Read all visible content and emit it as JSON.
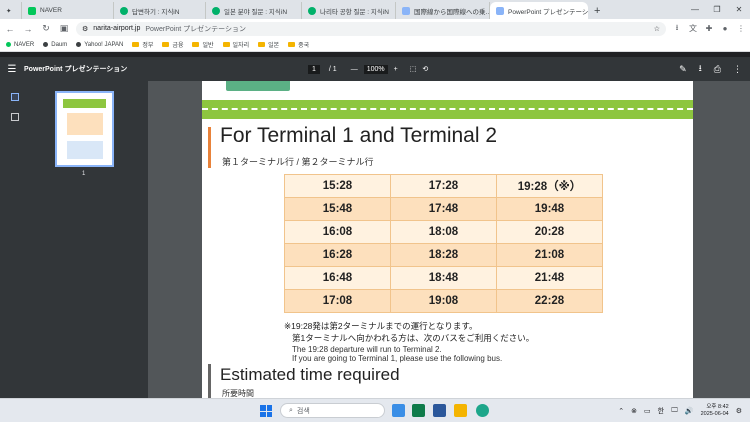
{
  "tabs": [
    {
      "label": "NAVER",
      "color": "#03c75a"
    },
    {
      "label": "답변하기 : 지식iN",
      "color": "#00b16a"
    },
    {
      "label": "일본 분야 질문 : 지식iN",
      "color": "#00b16a"
    },
    {
      "label": "나리타 공항 질문 : 지식iN",
      "color": "#00b16a"
    },
    {
      "label": "国際線から国際線への乗…",
      "color": "#8ab4f8"
    },
    {
      "label": "PowerPoint プレゼンテーション",
      "color": "#8ab4f8",
      "active": true
    }
  ],
  "address": {
    "host": "narita-airport.jp",
    "title": "PowerPoint プレゼンテーション"
  },
  "bookmarks": [
    {
      "label": "NAVER",
      "type": "dot",
      "color": "#03c75a"
    },
    {
      "label": "Daum",
      "type": "dot",
      "color": "#3c4043"
    },
    {
      "label": "Yahoo! JAPAN",
      "type": "dot",
      "color": "#3c4043"
    },
    {
      "label": "정부",
      "type": "folder"
    },
    {
      "label": "금융",
      "type": "folder"
    },
    {
      "label": "일반",
      "type": "folder"
    },
    {
      "label": "일자리",
      "type": "folder"
    },
    {
      "label": "일본",
      "type": "folder"
    },
    {
      "label": "중국",
      "type": "folder"
    }
  ],
  "pdf": {
    "title": "PowerPoint プレゼンテーション",
    "page": "1",
    "pages": "/ 1",
    "zoom": "100%",
    "thumb_number": "1"
  },
  "doc": {
    "heading": "For Terminal 1 and Terminal 2",
    "subheading": "第１ターミナル行 / 第２ターミナル行",
    "timetable": [
      [
        "15:28",
        "17:28",
        "19:28（※）"
      ],
      [
        "15:48",
        "17:48",
        "19:48"
      ],
      [
        "16:08",
        "18:08",
        "20:28"
      ],
      [
        "16:28",
        "18:28",
        "21:08"
      ],
      [
        "16:48",
        "18:48",
        "21:48"
      ],
      [
        "17:08",
        "19:08",
        "22:28"
      ]
    ],
    "note_line1": "※19:28発は第2ターミナルまでの運行となります。",
    "note_line2": "第1ターミナルへ向かわれる方は、次のバスをご利用ください。",
    "note_en1": "The 19:28 departure will run to Terminal 2.",
    "note_en2": "If you are going to Terminal 1, please use the following bus.",
    "heading2": "Estimated time required",
    "subheading2": "所要時間"
  },
  "taskbar": {
    "search_placeholder": "검색",
    "ime": "한",
    "time": "오후 8:42",
    "date": "2025-06-04"
  }
}
